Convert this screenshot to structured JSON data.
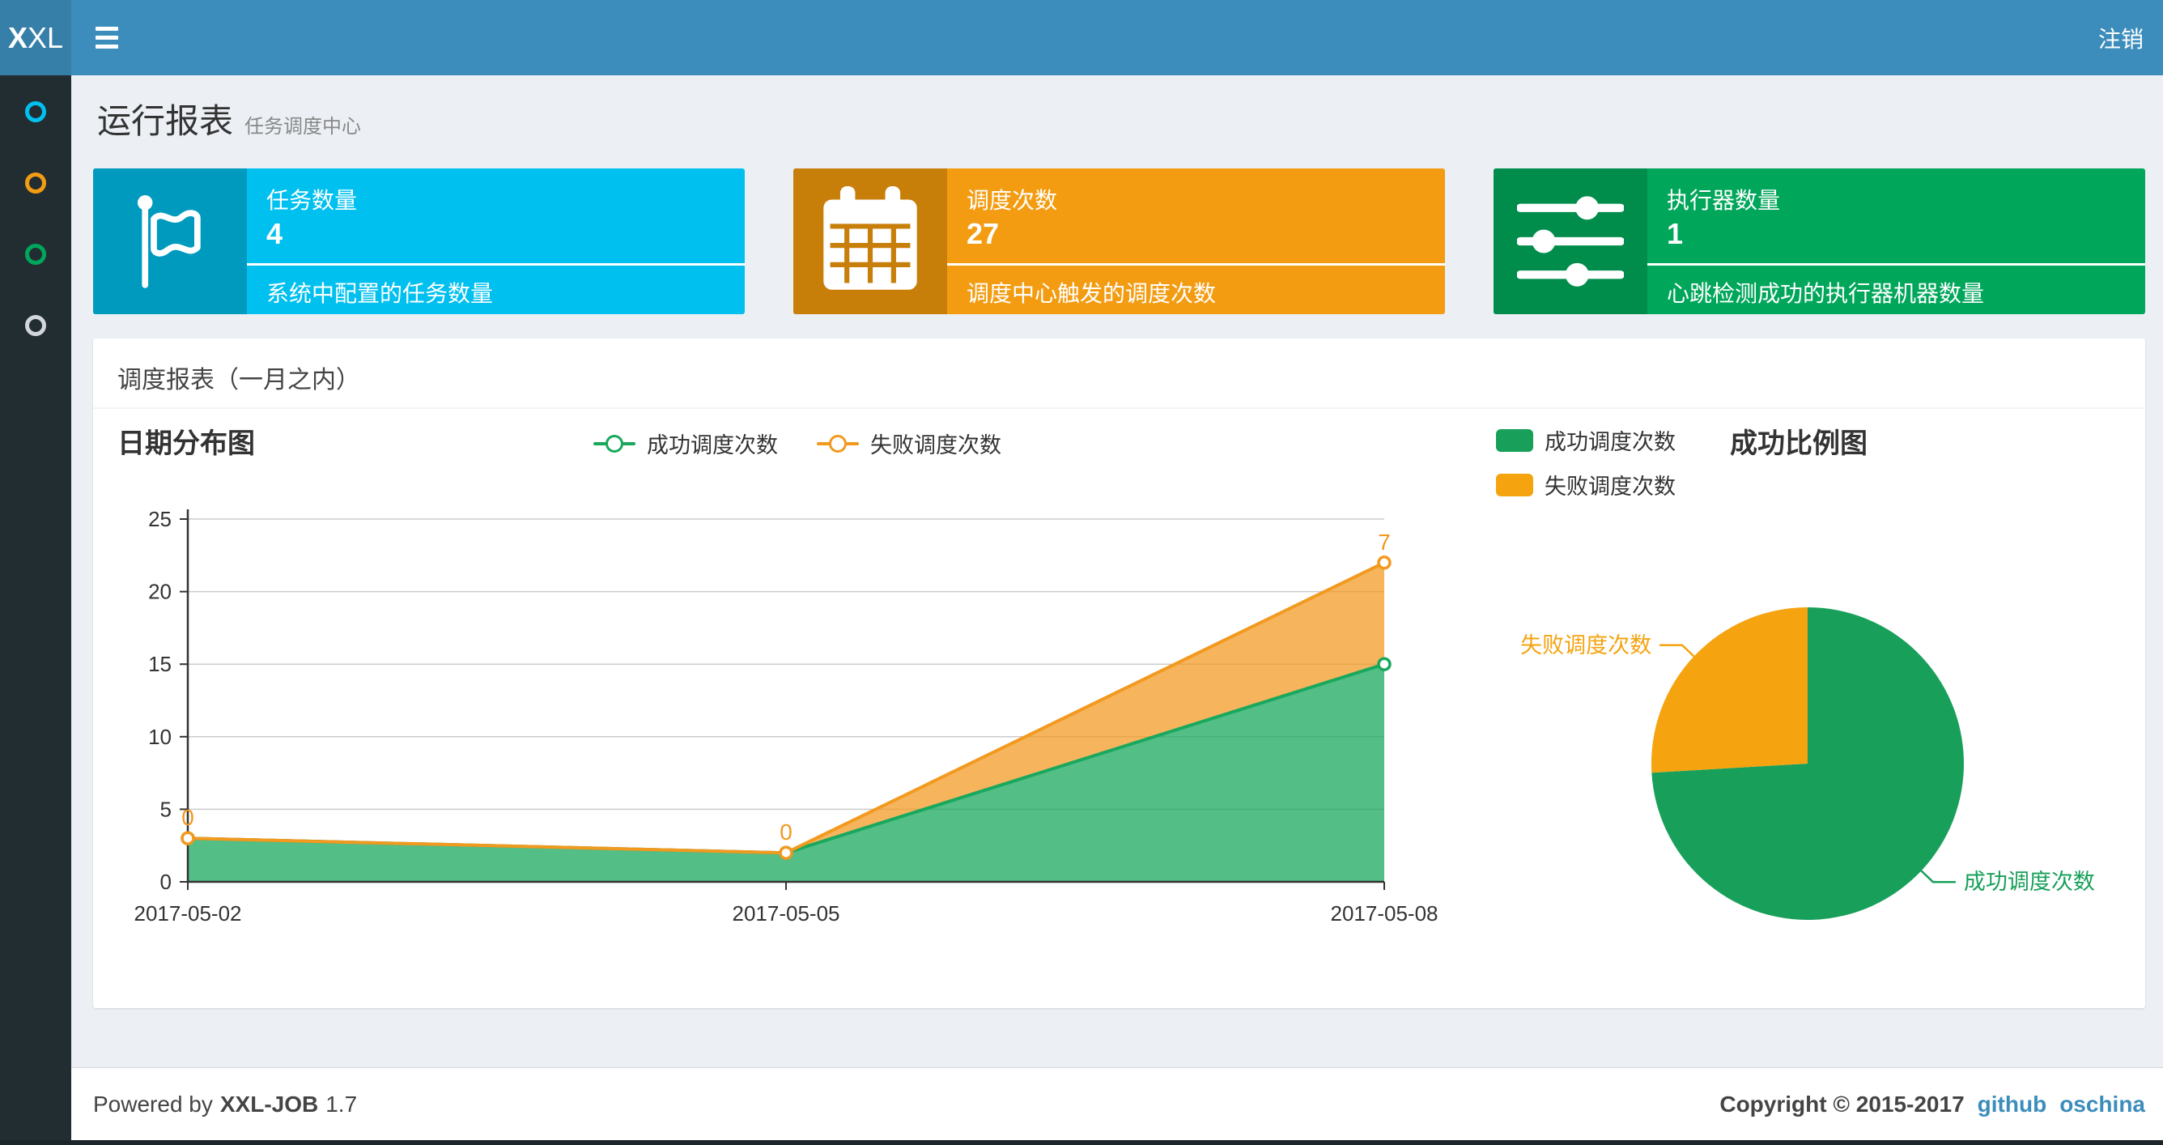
{
  "navbar": {
    "logo_bold": "X",
    "logo_rest": "XL",
    "logout": "注销",
    "bg_color": "#3c8dbc",
    "logo_bg_color": "#367fa9"
  },
  "sidebar": {
    "bg_color": "#222d32",
    "icons": [
      {
        "icon": "circle-icon",
        "color": "#00c0ef"
      },
      {
        "icon": "circle-icon",
        "color": "#f39c12"
      },
      {
        "icon": "circle-icon",
        "color": "#00a65a"
      },
      {
        "icon": "circle-icon",
        "color": "#d2d6de"
      }
    ]
  },
  "page": {
    "title": "运行报表",
    "subtitle": "任务调度中心"
  },
  "info_boxes": [
    {
      "label": "任务数量",
      "value": "4",
      "desc": "系统中配置的任务数量",
      "color": "#00c0ef",
      "icon_bg": "#009abf",
      "icon": "flag-icon"
    },
    {
      "label": "调度次数",
      "value": "27",
      "desc": "调度中心触发的调度次数",
      "color": "#f39c12",
      "icon_bg": "#c87f0a",
      "icon": "calendar-icon"
    },
    {
      "label": "执行器数量",
      "value": "1",
      "desc": "心跳检测成功的执行器机器数量",
      "color": "#00a65a",
      "icon_bg": "#008d4c",
      "icon": "sliders-icon"
    }
  ],
  "panel": {
    "title": "调度报表（一月之内）"
  },
  "chart_data": [
    {
      "type": "area",
      "title": "日期分布图",
      "categories": [
        "2017-05-02",
        "2017-05-05",
        "2017-05-08"
      ],
      "stacked": true,
      "grid": true,
      "legend_position": "top",
      "xlabel": "",
      "ylabel": "",
      "ylim": [
        0,
        25
      ],
      "yticks": [
        0,
        5,
        10,
        15,
        20,
        25
      ],
      "series": [
        {
          "name": "成功调度次数",
          "values": [
            3,
            2,
            15
          ],
          "color": "#19a85e",
          "fill_opacity": 0.75
        },
        {
          "name": "失败调度次数",
          "values": [
            0,
            0,
            7
          ],
          "color": "#f2991f",
          "fill_opacity": 0.72,
          "point_labels": [
            "0",
            "0",
            "7"
          ]
        }
      ]
    },
    {
      "type": "pie",
      "title": "成功比例图",
      "slices": [
        {
          "name": "成功调度次数",
          "value": 20,
          "color": "#18a05a"
        },
        {
          "name": "失败调度次数",
          "value": 7,
          "color": "#f5a30f"
        }
      ]
    }
  ],
  "footer": {
    "powered_prefix": "Powered by",
    "brand": "XXL-JOB",
    "version": "1.7",
    "copyright": "Copyright © 2015-2017",
    "links": [
      {
        "label": "github"
      },
      {
        "label": "oschina"
      }
    ],
    "link_color": "#3c8dbc"
  }
}
